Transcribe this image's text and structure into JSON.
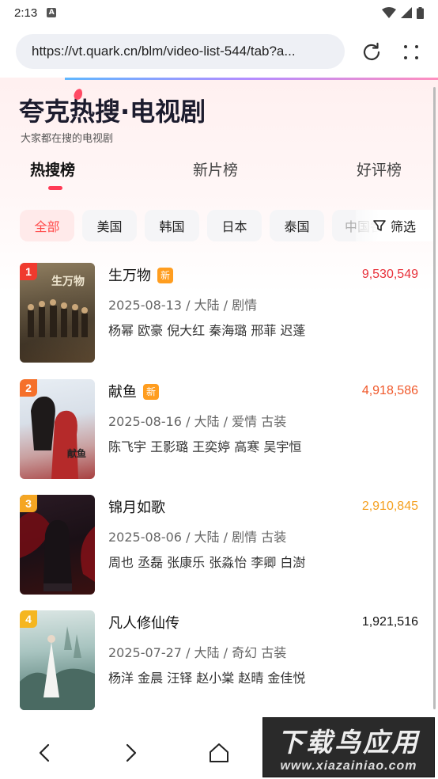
{
  "status_bar": {
    "time": "2:13",
    "notification_icon": "a-icon"
  },
  "browser": {
    "url": "https://vt.quark.cn/blm/video-list-544/tab?a...",
    "refresh_icon": "refresh-icon",
    "more_icon": "more-dots-icon"
  },
  "header": {
    "title": "夸克热搜·电视剧",
    "subtitle": "大家都在搜的电视剧"
  },
  "tabs": [
    {
      "label": "热搜榜",
      "active": true
    },
    {
      "label": "新片榜",
      "active": false
    },
    {
      "label": "好评榜",
      "active": false
    }
  ],
  "chips": [
    {
      "label": "全部",
      "active": true
    },
    {
      "label": "美国",
      "active": false
    },
    {
      "label": "韩国",
      "active": false
    },
    {
      "label": "日本",
      "active": false
    },
    {
      "label": "泰国",
      "active": false
    },
    {
      "label": "中国香",
      "active": false
    }
  ],
  "filter_label": "筛选",
  "items": [
    {
      "rank": "1",
      "title": "生万物",
      "badge": "新",
      "meta": "2025-08-13 / 大陆 / 剧情",
      "cast": "杨幂 欧豪 倪大红 秦海璐 邢菲 迟蓬",
      "score": "9,530,549",
      "score_color": "#e8303a",
      "rank_color": "#f03a2e"
    },
    {
      "rank": "2",
      "title": "献鱼",
      "badge": "新",
      "meta": "2025-08-16 / 大陆 / 爱情 古装",
      "cast": "陈飞宇 王影璐 王奕婷 高寒 吴宇恒",
      "score": "4,918,586",
      "score_color": "#f0582a",
      "rank_color": "#f5702a"
    },
    {
      "rank": "3",
      "title": "锦月如歌",
      "badge": "",
      "meta": "2025-08-06 / 大陆 / 剧情 古装",
      "cast": "周也 丞磊 张康乐 张淼怡 李卿 白澍",
      "score": "2,910,845",
      "score_color": "#f5a020",
      "rank_color": "#f5a623"
    },
    {
      "rank": "4",
      "title": "凡人修仙传",
      "badge": "",
      "meta": "2025-07-27 / 大陆 / 奇幻 古装",
      "cast": "杨洋 金晨 汪铎 赵小棠 赵晴 金佳悦",
      "score": "1,921,516",
      "score_color": "#111111",
      "rank_color": "#f5b620"
    }
  ],
  "nav": {
    "back_icon": "back-chevron-icon",
    "forward_icon": "forward-chevron-icon",
    "home_icon": "home-icon"
  },
  "watermark": {
    "main": "下载鸟应用",
    "sub": "www.xiazainiao.com"
  }
}
